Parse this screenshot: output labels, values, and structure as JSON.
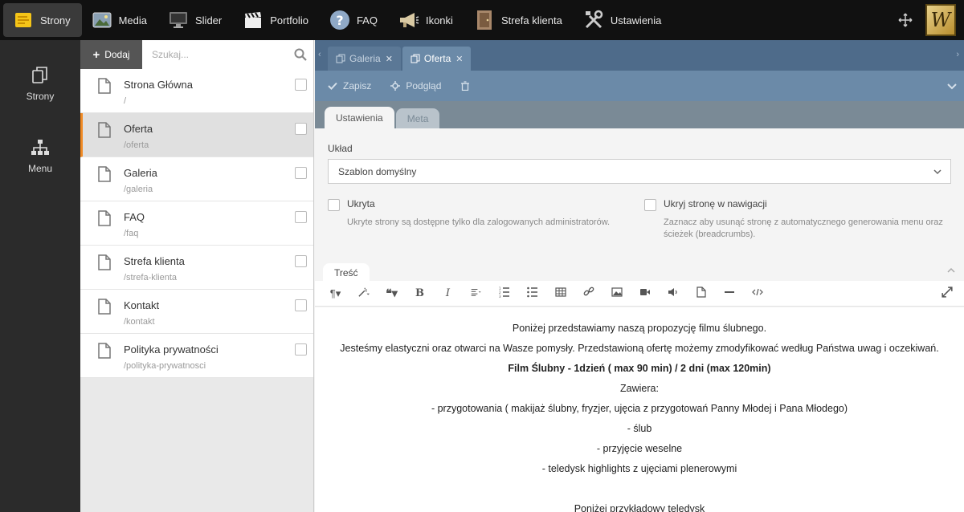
{
  "topnav": {
    "items": [
      {
        "label": "Strony",
        "icon": "sticky-notes-icon"
      },
      {
        "label": "Media",
        "icon": "image-icon"
      },
      {
        "label": "Slider",
        "icon": "monitor-icon"
      },
      {
        "label": "Portfolio",
        "icon": "clapperboard-icon"
      },
      {
        "label": "FAQ",
        "icon": "question-icon"
      },
      {
        "label": "Ikonki",
        "icon": "megaphone-icon"
      },
      {
        "label": "Strefa klienta",
        "icon": "door-icon"
      },
      {
        "label": "Ustawienia",
        "icon": "tools-icon"
      }
    ],
    "logo_letter": "W"
  },
  "sidebar": {
    "items": [
      {
        "label": "Strony",
        "icon": "pages-icon"
      },
      {
        "label": "Menu",
        "icon": "sitemap-icon"
      }
    ]
  },
  "pages_panel": {
    "add_label": "Dodaj",
    "search_placeholder": "Szukaj...",
    "pages": [
      {
        "title": "Strona Główna",
        "url": "/"
      },
      {
        "title": "Oferta",
        "url": "/oferta"
      },
      {
        "title": "Galeria",
        "url": "/galeria"
      },
      {
        "title": "FAQ",
        "url": "/faq"
      },
      {
        "title": "Strefa klienta",
        "url": "/strefa-klienta"
      },
      {
        "title": "Kontakt",
        "url": "/kontakt"
      },
      {
        "title": "Polityka prywatności",
        "url": "/polityka-prywatnosci"
      }
    ]
  },
  "editor_tabs": [
    {
      "label": "Galeria"
    },
    {
      "label": "Oferta"
    }
  ],
  "actions": {
    "save": "Zapisz",
    "preview": "Podgląd"
  },
  "settings_tabs": {
    "settings": "Ustawienia",
    "meta": "Meta"
  },
  "form": {
    "layout_label": "Układ",
    "layout_value": "Szablon domyślny",
    "hidden_title": "Ukryta",
    "hidden_desc": "Ukryte strony są dostępne tylko dla zalogowanych administratorów.",
    "hide_nav_title": "Ukryj stronę w nawigacji",
    "hide_nav_desc": "Zaznacz aby usunąć stronę z automatycznego generowania menu oraz ścieżek (breadcrumbs)."
  },
  "content": {
    "tab_label": "Treść",
    "paragraphs": [
      "Poniżej przedstawiamy naszą propozycję filmu ślubnego.",
      "Jesteśmy elastyczni oraz otwarci na Wasze pomysły. Przedstawioną ofertę możemy  zmodyfikować według Państwa uwag i oczekiwań.",
      "Film Ślubny  -  1dzień ( max 90 min) / 2 dni (max 120min)",
      "Zawiera:",
      "- przygotowania ( makijaż ślubny, fryzjer, ujęcia z przygotowań Panny Młodej i Pana Młodego)",
      "- ślub",
      "- przyjęcie weselne",
      "- teledysk highlights z ujęciami plenerowymi",
      "",
      "Poniżej przykładowy teledysk"
    ]
  },
  "colors": {
    "accent_selected": "#f08a24",
    "tabbar": "#4e6b8a",
    "actionbar": "#6b8aa8"
  }
}
